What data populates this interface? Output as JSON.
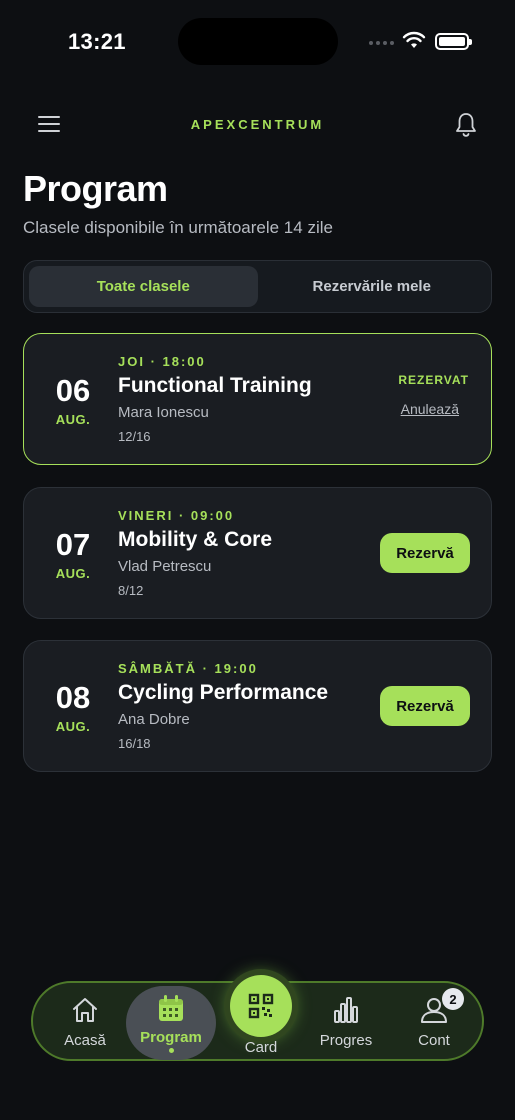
{
  "status_bar": {
    "time": "13:21"
  },
  "header": {
    "brand": "APEXCENTRUM"
  },
  "page": {
    "title": "Program",
    "subtitle": "Clasele disponibile în următoarele 14 zile"
  },
  "tabs": [
    {
      "label": "Toate clasele",
      "active": true
    },
    {
      "label": "Rezervările mele",
      "active": false
    }
  ],
  "classes": [
    {
      "day": "06",
      "month": "AUG.",
      "when": "JOI · 18:00",
      "name": "Functional Training",
      "trainer": "Mara Ionescu",
      "spots": "12/16",
      "status": "REZERVAT",
      "cancel_label": "Anulează"
    },
    {
      "day": "07",
      "month": "AUG.",
      "when": "VINERI · 09:00",
      "name": "Mobility & Core",
      "trainer": "Vlad Petrescu",
      "spots": "8/12",
      "action_label": "Rezervă"
    },
    {
      "day": "08",
      "month": "AUG.",
      "when": "SÂMBĂTĂ · 19:00",
      "name": "Cycling Performance",
      "trainer": "Ana Dobre",
      "spots": "16/18",
      "action_label": "Rezervă"
    }
  ],
  "bottom_nav": {
    "items": [
      {
        "label": "Acasă",
        "icon": "home-icon"
      },
      {
        "label": "Program",
        "icon": "calendar-icon",
        "active": true
      },
      {
        "label": "Card",
        "icon": "qr-code-icon"
      },
      {
        "label": "Progres",
        "icon": "bar-chart-icon"
      },
      {
        "label": "Cont",
        "icon": "user-icon",
        "badge": "2"
      }
    ]
  },
  "colors": {
    "accent": "#a6e05a",
    "background": "#0d0f12",
    "card": "#1a1d22"
  }
}
